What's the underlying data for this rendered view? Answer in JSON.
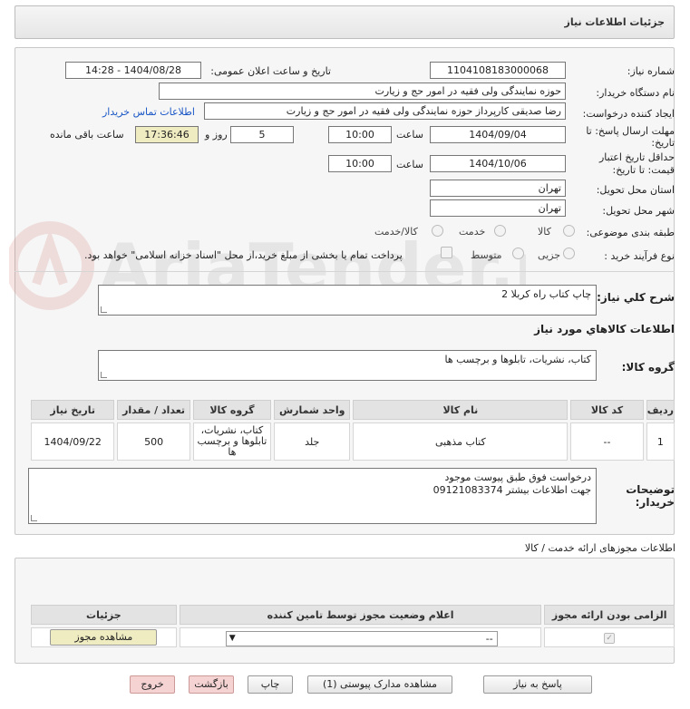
{
  "header": {
    "title": "جزئیات اطلاعات نیاز"
  },
  "watermark": {
    "text": "AriaTender.neT"
  },
  "form": {
    "need_number_label": "شماره نیاز:",
    "need_number": "1104108183000068",
    "announce_label": "تاریخ و ساعت اعلان عمومی:",
    "announce_value": "1404/08/28 - 14:28",
    "buyer_label": "نام دستگاه خریدار:",
    "buyer_value": "حوزه نمایندگی ولی فقیه در امور حج و زیارت",
    "creator_label": "ایجاد کننده درخواست:",
    "creator_value": "رضا صدیقی کارپرداز حوزه نمایندگی ولی فقیه در امور حج و زیارت",
    "contact_link": "اطلاعات تماس خریدار",
    "deadline_label_1": "مهلت ارسال پاسخ: تا",
    "deadline_label_2": "تاریخ:",
    "deadline_date": "1404/09/04",
    "time_label": "ساعت",
    "deadline_time": "10:00",
    "days_value": "5",
    "days_label": "روز و",
    "remaining_time": "17:36:46",
    "remaining_label": "ساعت باقی مانده",
    "validity_label_1": "حداقل تاریخ اعتبار",
    "validity_label_2": "قیمت: تا تاریخ:",
    "validity_date": "1404/10/06",
    "validity_time": "10:00",
    "province_label": "استان محل تحویل:",
    "province_value": "تهران",
    "city_label": "شهر محل تحویل:",
    "city_value": "تهران",
    "category_label": "طبقه بندی موضوعی:",
    "category_options": [
      "کالا",
      "خدمت",
      "کالا/خدمت"
    ],
    "process_label": "نوع فرآیند خرید :",
    "process_options": [
      "جزیی",
      "متوسط"
    ],
    "payment_note": "پرداخت تمام یا بخشی از مبلغ خرید،از محل \"اسناد خزانه اسلامی\" خواهد بود."
  },
  "summary": {
    "label": "شرح کلي نياز:",
    "value": "چاپ کتاب راه کربلا 2"
  },
  "goods": {
    "section_title": "اطلاعات کالاهاي مورد نياز",
    "group_label": "گروه کالا:",
    "group_value": "کتاب، نشریات، تابلوها و برچسب ها",
    "columns": [
      "ردیف",
      "کد کالا",
      "نام کالا",
      "واحد شمارش",
      "گروه کالا",
      "تعداد / مقدار",
      "تاریخ نیاز"
    ],
    "rows": [
      [
        "1",
        "--",
        "کتاب مذهبی",
        "جلد",
        "کتاب، نشریات، تابلوها و برچسب ها",
        "500",
        "1404/09/22"
      ]
    ]
  },
  "notes": {
    "label_1": "توضیحات",
    "label_2": "خریدار:",
    "line_1": "درخواست فوق طبق پیوست موجود",
    "line_2": "جهت اطلاعات بیشتر   09121083374"
  },
  "permits": {
    "section_title": "اطلاعات مجوزهای ارائه خدمت / کالا",
    "columns": [
      "الزامی بودن ارائه مجوز",
      "اعلام وضعیت مجوز توسط تامین کننده",
      "جزئیات"
    ],
    "select_value": "--",
    "view_button": "مشاهده مجوز"
  },
  "footer": {
    "reply": "پاسخ به نیاز",
    "attachments": "مشاهده مدارک پیوستی (1)",
    "print": "چاپ",
    "back": "بازگشت",
    "exit": "خروج"
  }
}
